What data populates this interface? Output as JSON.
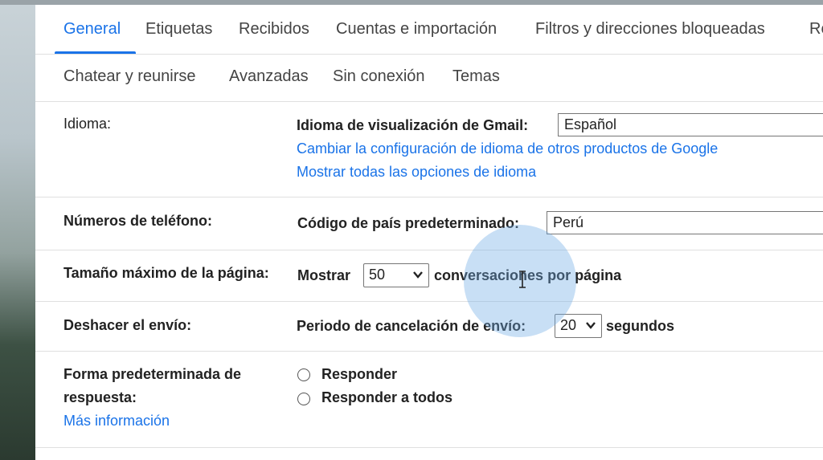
{
  "tabs": {
    "row1": [
      "General",
      "Etiquetas",
      "Recibidos",
      "Cuentas e importación",
      "Filtros y direcciones bloqueadas",
      "Re"
    ],
    "row2": [
      "Chatear y reunirse",
      "Avanzadas",
      "Sin conexión",
      "Temas"
    ]
  },
  "language": {
    "label": "Idioma:",
    "display_label": "Idioma de visualización de Gmail:",
    "display_value": "Español",
    "link_other_products": "Cambiar la configuración de idioma de otros productos de Google",
    "link_all_options": "Mostrar todas las opciones de idioma"
  },
  "phone": {
    "label": "Números de teléfono:",
    "country_label": "Código de país predeterminado:",
    "country_value": "Perú"
  },
  "page_size": {
    "label": "Tamaño máximo de la página:",
    "prefix": "Mostrar",
    "value": "50",
    "suffix": "conversaciones por página"
  },
  "undo_send": {
    "label": "Deshacer el envío:",
    "prefix": "Periodo de cancelación de envío:",
    "value": "20",
    "suffix": "segundos"
  },
  "reply": {
    "label_line1": "Forma predeterminada de",
    "label_line2": "respuesta:",
    "more_info": "Más información",
    "options": [
      "Responder",
      "Responder a todos"
    ]
  },
  "colors": {
    "accent": "#1a73e8",
    "text": "#222222",
    "divider": "#e0e0e0"
  }
}
